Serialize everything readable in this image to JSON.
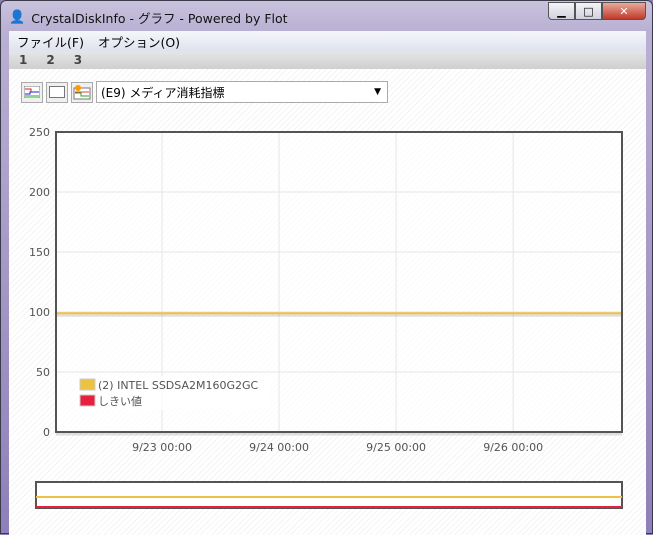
{
  "window": {
    "title": "CrystalDiskInfo - グラフ - Powered by Flot",
    "minimize": "▁",
    "maximize": "□",
    "close": "✕"
  },
  "menu": [
    "ファイル(F)",
    "オプション(O)"
  ],
  "tabs": [
    "1",
    "2",
    "3"
  ],
  "toolbar": {
    "select_value": "(E9) メディア消耗指標",
    "icons": [
      "all-lines-icon",
      "blank-icon",
      "clear-icon"
    ]
  },
  "colors": {
    "series1": "#edc240",
    "threshold": "#e8203f"
  },
  "chart_data": {
    "type": "line",
    "ylim": [
      0,
      250
    ],
    "yticks": [
      "0",
      "50",
      "100",
      "150",
      "200",
      "250"
    ],
    "ytick_values": [
      0,
      50,
      100,
      150,
      200,
      250
    ],
    "xticks": [
      "9/23 00:00",
      "9/24 00:00",
      "9/25 00:00",
      "9/26 00:00"
    ],
    "xtick_values": [
      1,
      2,
      3,
      4
    ],
    "xlim": [
      0.094,
      4.93
    ],
    "series": [
      {
        "name": "(2) INTEL SSDSA2M160G2GC",
        "x": [
          0.094,
          4.93
        ],
        "y": [
          99,
          99
        ]
      },
      {
        "name": "しきい値",
        "x": [
          0.094,
          4.93
        ],
        "y": [
          0,
          0
        ]
      }
    ],
    "legend": "bottom-left",
    "grid": true
  }
}
